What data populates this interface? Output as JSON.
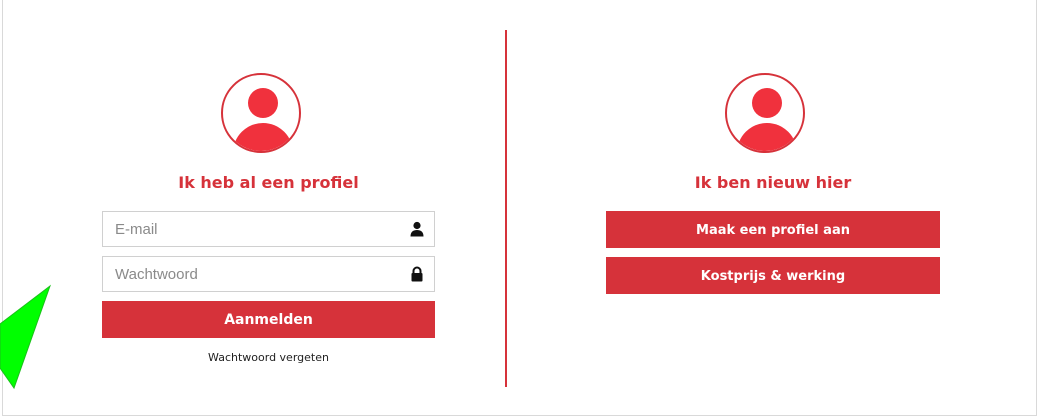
{
  "login": {
    "heading": "Ik heb al een profiel",
    "email_placeholder": "E-mail",
    "password_placeholder": "Wachtwoord",
    "submit_label": "Aanmelden",
    "forgot_label": "Wachtwoord vergeten",
    "icons": {
      "email": "user-icon",
      "password": "lock-icon"
    }
  },
  "register": {
    "heading": "Ik ben nieuw hier",
    "create_label": "Maak een profiel aan",
    "pricing_label": "Kostprijs & werking"
  },
  "colors": {
    "accent": "#d6323a",
    "avatar": "#f0313d",
    "pointer": "#00ff00"
  }
}
